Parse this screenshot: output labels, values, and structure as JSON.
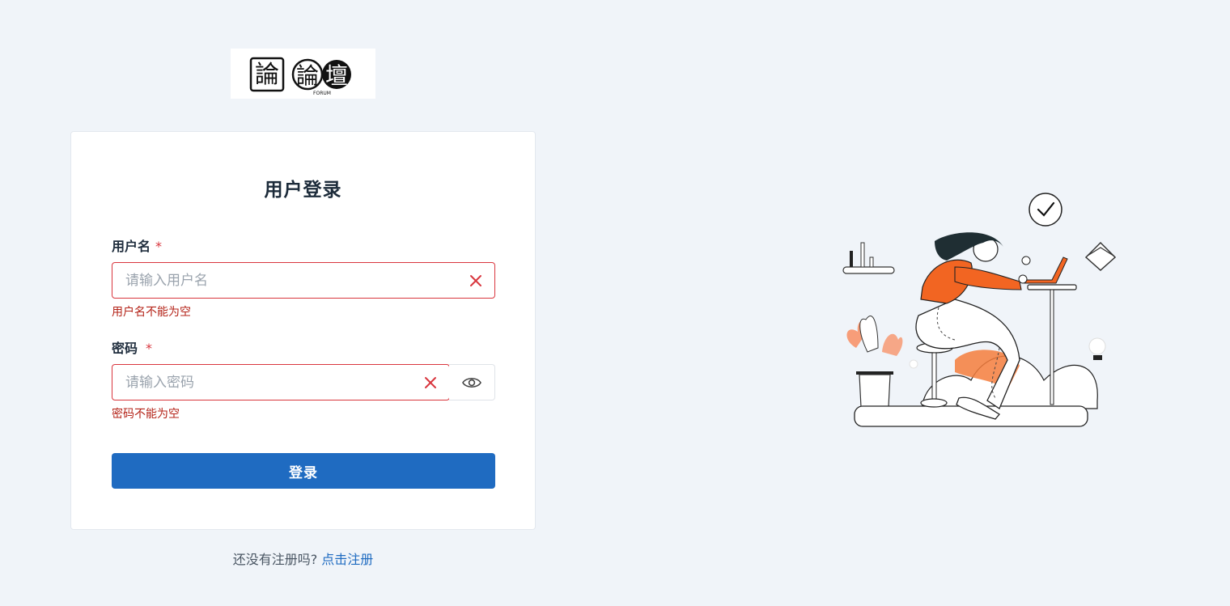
{
  "logo": {
    "glyph_square": "論",
    "glyph_circle_1": "論",
    "glyph_circle_2": "壇",
    "caption": "FORUM"
  },
  "login": {
    "title": "用户登录",
    "username": {
      "label": "用户名",
      "required_mark": "*",
      "placeholder": "请输入用户名",
      "value": "",
      "error": "用户名不能为空"
    },
    "password": {
      "label": "密码",
      "required_mark": "*",
      "placeholder": "请输入密码",
      "value": "",
      "error": "密码不能为空"
    },
    "submit_label": "登录"
  },
  "register": {
    "prompt": "还没有注册吗?",
    "link": "点击注册"
  },
  "icons": {
    "username_clear": "close-icon",
    "password_clear": "close-icon",
    "password_toggle": "eye-icon"
  },
  "colors": {
    "background": "#f0f4f9",
    "primary": "#1f6bc1",
    "error": "#d9363e",
    "accent_orange": "#f26522"
  }
}
